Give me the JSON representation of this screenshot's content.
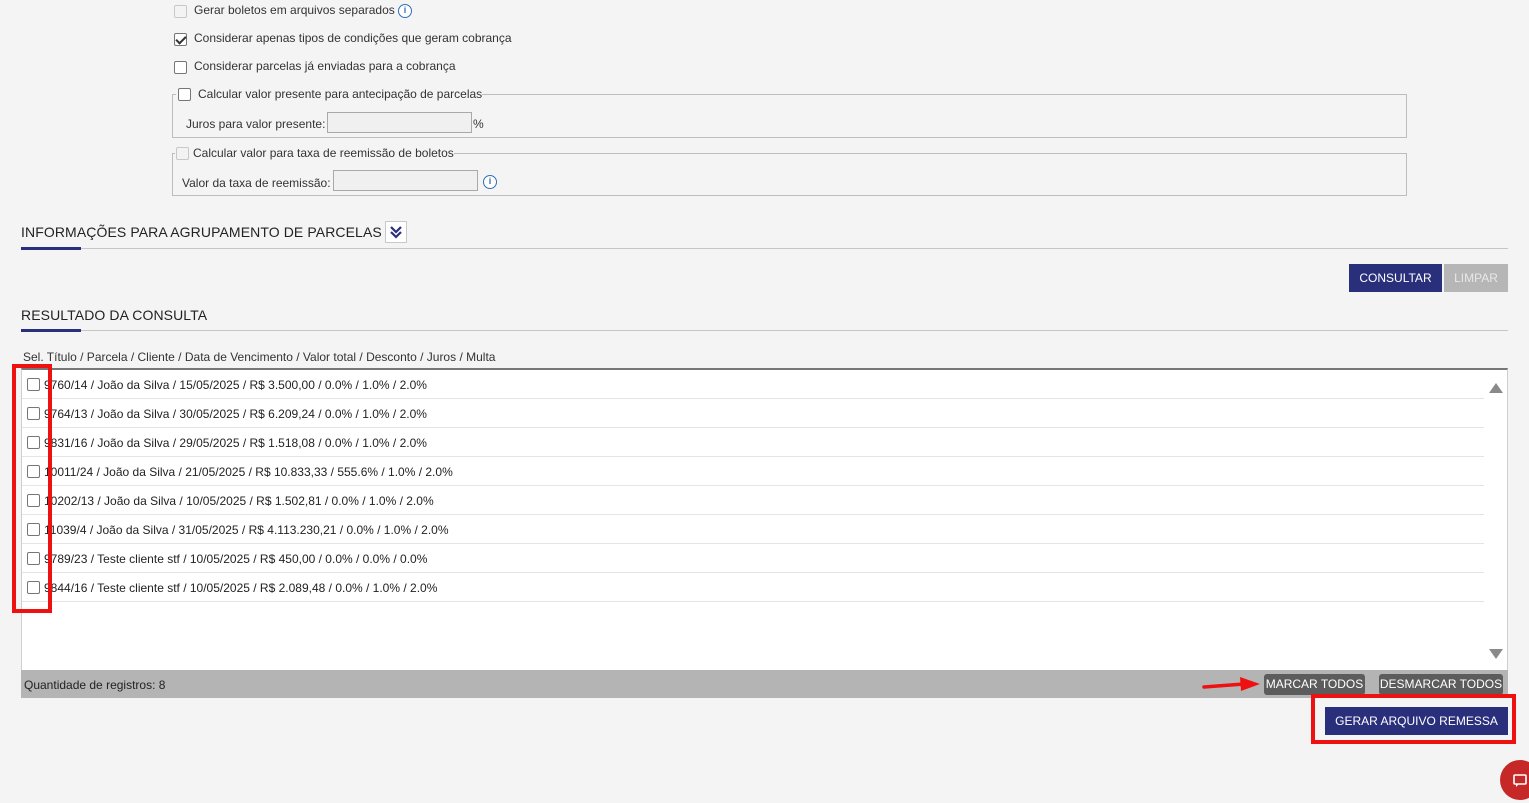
{
  "options": {
    "separate_files_label": "Gerar boletos em arquivos separados",
    "only_billing_types_label": "Considerar apenas tipos de condições que geram cobrança",
    "already_sent_label": "Considerar parcelas já enviadas para a cobrança"
  },
  "present_value": {
    "legend": "Calcular valor presente para antecipação de parcelas",
    "rate_label": "Juros para valor presente:",
    "rate_value": "",
    "unit": "%"
  },
  "reissue_fee": {
    "legend": "Calcular valor para taxa de reemissão de boletos",
    "fee_label": "Valor da taxa de reemissão:",
    "fee_value": ""
  },
  "grouping_section": {
    "title": "INFORMAÇÕES PARA AGRUPAMENTO DE PARCELAS"
  },
  "actions": {
    "consult_label": "CONSULTAR",
    "clear_label": "LIMPAR"
  },
  "results": {
    "title": "RESULTADO DA CONSULTA",
    "column_header": "Sel. Título / Parcela / Cliente / Data de Vencimento / Valor total / Desconto / Juros / Multa",
    "rows": [
      "9760/14 / João da Silva / 15/05/2025 / R$ 3.500,00 / 0.0% / 1.0% / 2.0%",
      "9764/13 / João da Silva / 30/05/2025 / R$ 6.209,24 / 0.0% / 1.0% / 2.0%",
      "9831/16 / João da Silva / 29/05/2025 / R$ 1.518,08 / 0.0% / 1.0% / 2.0%",
      "10011/24 / João da Silva / 21/05/2025 / R$ 10.833,33 / 555.6% / 1.0% / 2.0%",
      "10202/13 / João da Silva / 10/05/2025 / R$ 1.502,81 / 0.0% / 1.0% / 2.0%",
      "11039/4 / João da Silva / 31/05/2025 / R$ 4.113.230,21 / 0.0% / 1.0% / 2.0%",
      "9789/23 / Teste cliente stf / 10/05/2025 / R$ 450,00 / 0.0% / 0.0% / 0.0%",
      "9844/16 / Teste cliente stf / 10/05/2025 / R$ 2.089,48 / 0.0% / 1.0% / 2.0%"
    ],
    "count_label": "Quantidade de registros: 8",
    "select_all_label": "MARCAR TODOS",
    "deselect_all_label": "DESMARCAR TODOS"
  },
  "generate_label": "GERAR ARQUIVO REMESSA",
  "icons": {
    "info": "info-icon",
    "expand": "double-chevron-down-icon",
    "scroll_up": "triangle-up-icon",
    "scroll_down": "triangle-down-icon",
    "chat": "chat-icon"
  },
  "colors": {
    "primary": "#2a2f7c",
    "annotation": "#ee1111"
  }
}
